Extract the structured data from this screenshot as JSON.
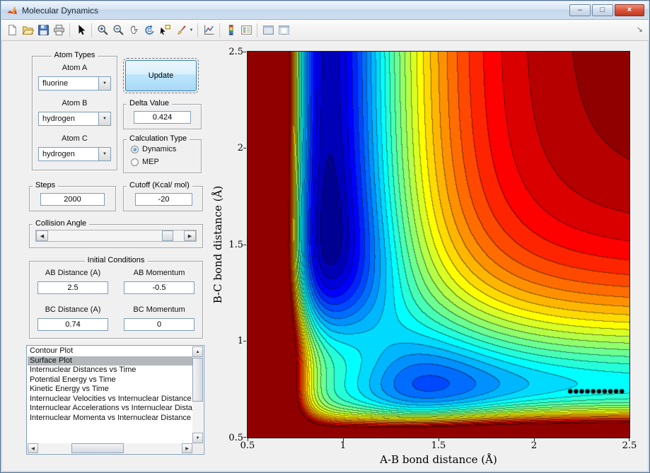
{
  "window": {
    "title": "Molecular Dynamics",
    "controls": {
      "minimize": "–",
      "restore": "□",
      "close": "×"
    }
  },
  "icons": {
    "up": "▲",
    "down": "▼",
    "left": "◀",
    "right": "▶",
    "combo_arrow": "▼",
    "brush_caret": "▼",
    "dock": "↘"
  },
  "toolbar": {
    "items": [
      "new-document",
      "open-file",
      "save-figure",
      "print-figure",
      "pointer",
      "zoom-in",
      "zoom-out",
      "pan",
      "rotate-3d",
      "data-cursor",
      "brush",
      "link-plots",
      "insert-colorbar",
      "insert-legend",
      "hide-plot-tools",
      "show-plot-tools"
    ]
  },
  "panels": {
    "atom_types": {
      "legend": "Atom Types",
      "atoms": [
        {
          "label": "Atom A",
          "value": "fluorine"
        },
        {
          "label": "Atom B",
          "value": "hydrogen"
        },
        {
          "label": "Atom C",
          "value": "hydrogen"
        }
      ]
    },
    "update_button_label": "Update",
    "delta": {
      "legend": "Delta Value",
      "value": "0.424"
    },
    "calculation_type": {
      "legend": "Calculation Type",
      "options": [
        {
          "label": "Dynamics",
          "selected": true
        },
        {
          "label": "MEP",
          "selected": false
        }
      ]
    },
    "steps": {
      "legend": "Steps",
      "value": "2000"
    },
    "cutoff": {
      "legend": "Cutoff (Kcal/ mol)",
      "value": "-20"
    },
    "collision_angle": {
      "legend": "Collision Angle"
    },
    "initial_conditions": {
      "legend": "Initial Conditions",
      "fields": [
        {
          "label": "AB Distance (A)",
          "value": "2.5"
        },
        {
          "label": "AB Momentum",
          "value": "-0.5"
        },
        {
          "label": "BC Distance (A)",
          "value": "0.74"
        },
        {
          "label": "BC Momentum",
          "value": "0"
        }
      ]
    },
    "plot_list": {
      "items": [
        "Contour Plot",
        "Surface Plot",
        "Internuclear Distances vs Time",
        "Potential Energy vs Time",
        "Kinetic Energy vs Time",
        "Internuclear Velocities vs Internuclear Distance",
        "Internuclear Accelerations vs Internuclear Dista",
        "Internuclear Momenta vs Internuclear Distance"
      ],
      "selected": "Surface Plot",
      "selected_index": 1
    }
  },
  "chart_data": {
    "type": "filled-contour",
    "xlabel": "A-B bond distance (Å)",
    "ylabel": "B-C bond distance (Å)",
    "xlim": [
      0.5,
      2.5
    ],
    "ylim": [
      0.5,
      2.5
    ],
    "xticks": [
      "0.5",
      "1",
      "1.5",
      "2",
      "2.5"
    ],
    "yticks": [
      "2.5",
      "2",
      "1.5",
      "1",
      "0.5"
    ],
    "colormap": "jet",
    "levels": 28,
    "vrange": [
      -106,
      0
    ],
    "potential": {
      "model": "V(x,y) = Morse(x;AB) + Morse(y;BC) + A*exp(-((x-cx)^2+(y-cy)^2)/w)",
      "AB": {
        "D": 100,
        "a": 3.2,
        "r0": 0.93
      },
      "BC": {
        "D": 65,
        "a": 3.4,
        "r0": 0.78
      },
      "coupling": {
        "A": 110,
        "cx": 0.85,
        "cy": 0.78,
        "w": 0.18
      }
    },
    "trajectory": {
      "y": 0.74,
      "x_start": 2.19,
      "x_end": 2.46,
      "n": 10
    }
  }
}
